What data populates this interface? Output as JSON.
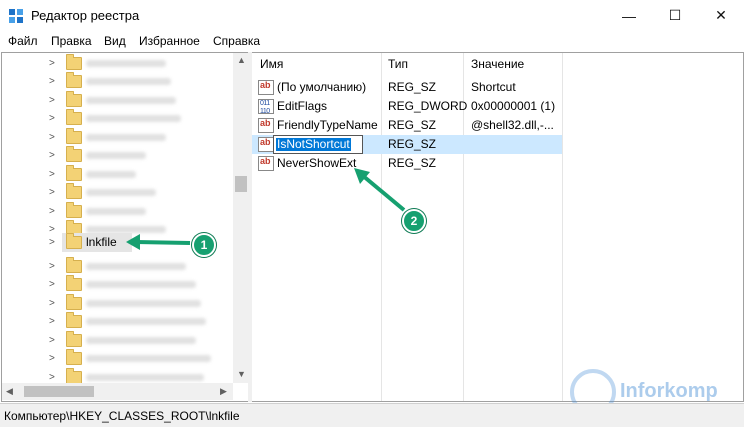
{
  "window": {
    "title": "Редактор реестра",
    "minimize_glyph": "—",
    "maximize_glyph": "☐",
    "close_glyph": "✕"
  },
  "menu": [
    "Файл",
    "Правка",
    "Вид",
    "Избранное",
    "Справка"
  ],
  "tree": {
    "selected_label": "lnkfile"
  },
  "list": {
    "headers": {
      "name": "Имя",
      "type": "Тип",
      "data": "Значение"
    },
    "rows": [
      {
        "icon": "string-value-icon",
        "name": "(По умолчанию)",
        "type": "REG_SZ",
        "data": "Shortcut"
      },
      {
        "icon": "binary-value-icon",
        "name": "EditFlags",
        "type": "REG_DWORD",
        "data": "0x00000001 (1)"
      },
      {
        "icon": "string-value-icon",
        "name": "FriendlyTypeName",
        "type": "REG_SZ",
        "data": "@shell32.dll,-..."
      },
      {
        "icon": "string-value-icon",
        "name": "IsNotShortcut",
        "type": "REG_SZ",
        "data": ""
      },
      {
        "icon": "string-value-icon",
        "name": "NeverShowExt",
        "type": "REG_SZ",
        "data": ""
      }
    ]
  },
  "status": {
    "path": "Компьютер\\HKEY_CLASSES_ROOT\\lnkfile"
  },
  "annotations": {
    "badge1": "1",
    "badge2": "2",
    "color": "#16a070"
  },
  "watermark": {
    "text": "Inforkomp"
  }
}
